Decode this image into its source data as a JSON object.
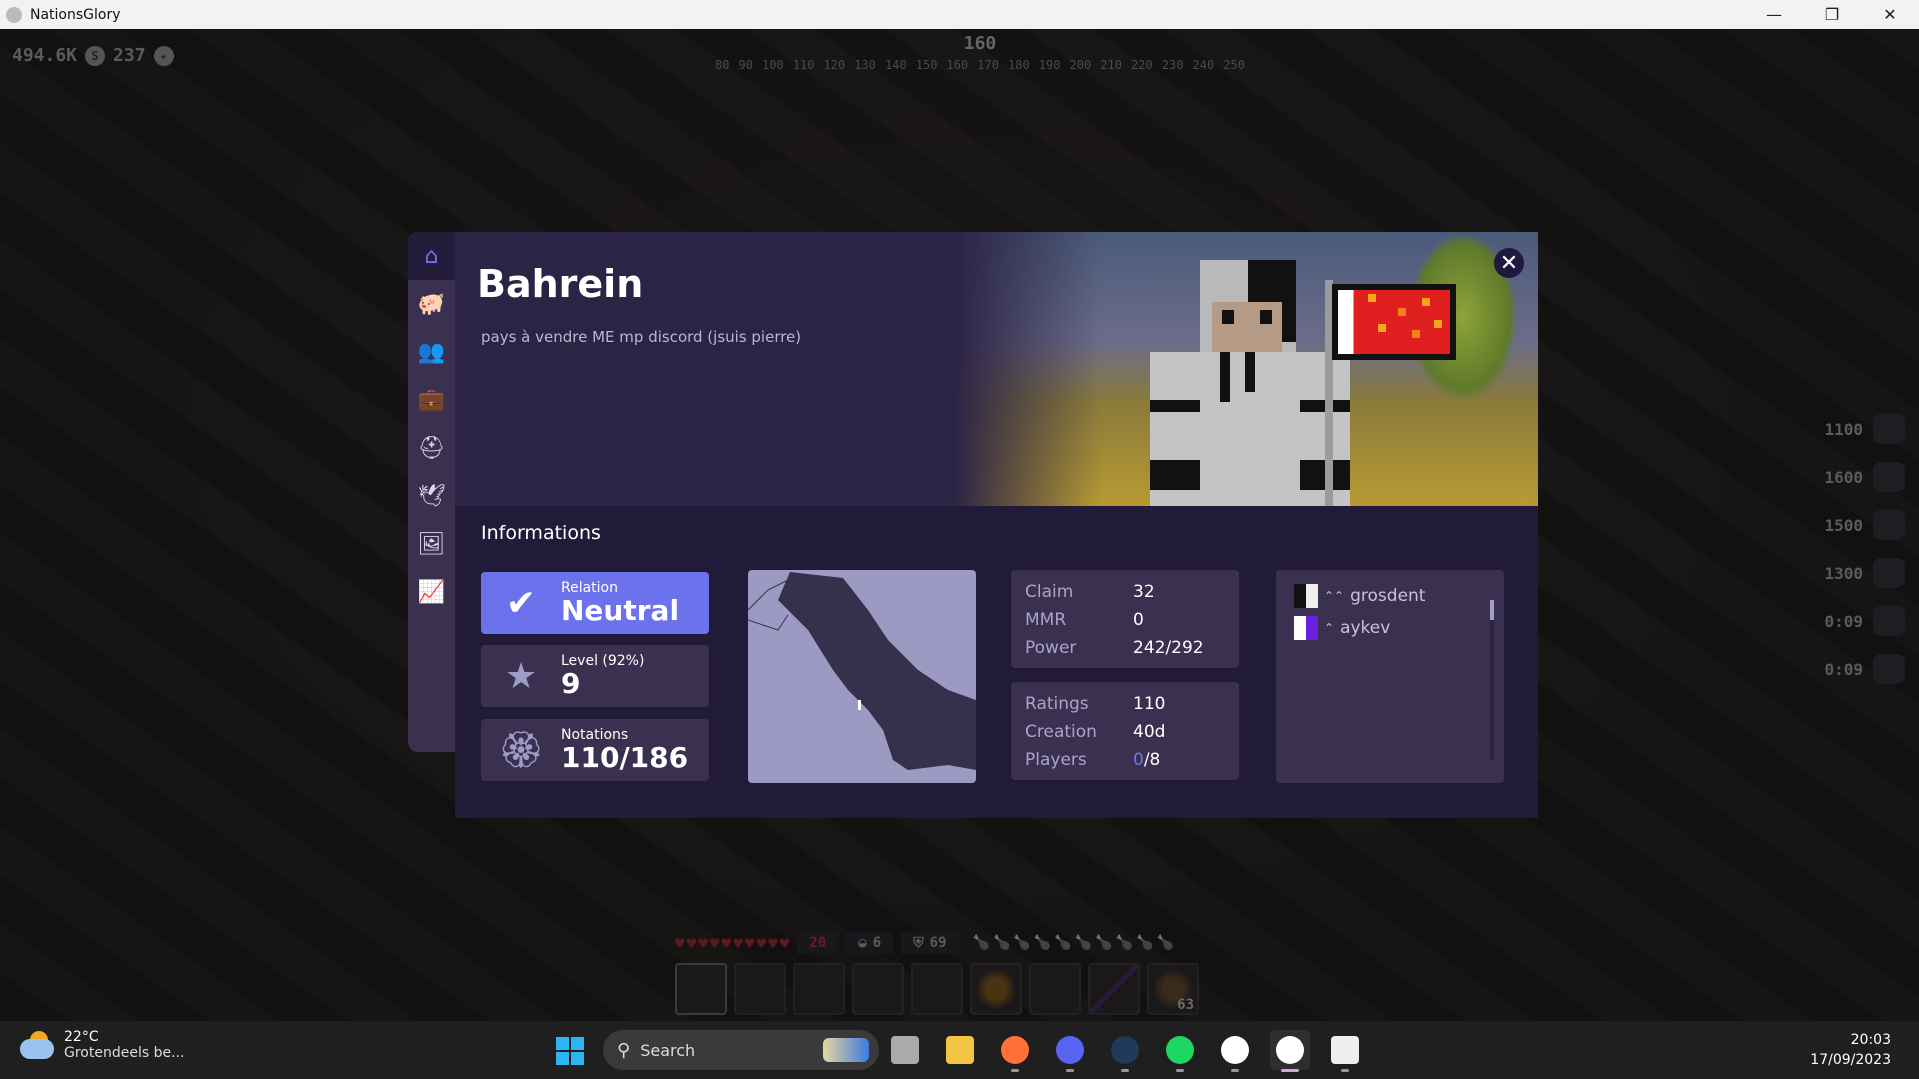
{
  "window": {
    "title": "NationsGlory",
    "controls": [
      {
        "name": "minimize",
        "glyph": "—"
      },
      {
        "name": "restore",
        "glyph": "❐"
      },
      {
        "name": "close",
        "glyph": "✕"
      }
    ]
  },
  "hud": {
    "money": "494.6K",
    "money_icon": "S",
    "points": "237",
    "points_icon": "✦",
    "compass_heading": "160",
    "compass_ticks": [
      "80",
      "90",
      "100",
      "110",
      "120",
      "130",
      "140",
      "150",
      "160",
      "170",
      "180",
      "190",
      "200",
      "210",
      "220",
      "230",
      "240",
      "250"
    ],
    "right_stats": [
      {
        "value": "1100",
        "icon": "helmet-icon"
      },
      {
        "value": "1600",
        "icon": "chestplate-icon"
      },
      {
        "value": "1500",
        "icon": "leggings-icon"
      },
      {
        "value": "1300",
        "icon": "boots-icon"
      },
      {
        "value": "0:09",
        "icon": "claw-effect-icon"
      },
      {
        "value": "0:09",
        "icon": "fire-effect-icon"
      }
    ],
    "hearts": 10,
    "health": "20",
    "mana": "6",
    "armor": "69",
    "food": 10,
    "hotbar": [
      {
        "item": "",
        "count": ""
      },
      {
        "item": "",
        "count": ""
      },
      {
        "item": "",
        "count": ""
      },
      {
        "item": "",
        "count": ""
      },
      {
        "item": "",
        "count": ""
      },
      {
        "item": "backpack",
        "count": ""
      },
      {
        "item": "",
        "count": ""
      },
      {
        "item": "sword",
        "count": ""
      },
      {
        "item": "food",
        "count": "63"
      }
    ]
  },
  "modal": {
    "sidebar": [
      {
        "name": "home",
        "glyph": "⌂",
        "active": true
      },
      {
        "name": "bank",
        "glyph": "🐖",
        "active": false
      },
      {
        "name": "members",
        "glyph": "👥",
        "active": false
      },
      {
        "name": "jobs",
        "glyph": "💼",
        "active": false
      },
      {
        "name": "military",
        "glyph": "⛑",
        "active": false
      },
      {
        "name": "diplomacy",
        "glyph": "🕊",
        "active": false
      },
      {
        "name": "gallery",
        "glyph": "🖼",
        "active": false
      },
      {
        "name": "stats",
        "glyph": "📈",
        "active": false
      }
    ],
    "country_name": "Bahrein",
    "description": "pays à vendre ME mp discord (jsuis pierre)",
    "close_glyph": "✕",
    "section_title": "Informations",
    "relation": {
      "label": "Relation",
      "value": "Neutral",
      "icon": "✔"
    },
    "level": {
      "label": "Level (92%)",
      "value": "9",
      "progress_percent": 92,
      "icon": "★"
    },
    "notations": {
      "label": "Notations",
      "value": "110/186",
      "icon": "🏵"
    },
    "stats_primary": [
      {
        "key": "Claim",
        "value": "32"
      },
      {
        "key": "MMR",
        "value": "0"
      },
      {
        "key": "Power",
        "value": "242/292"
      }
    ],
    "stats_secondary": [
      {
        "key": "Ratings",
        "value": "110"
      },
      {
        "key": "Creation",
        "value": "40d"
      },
      {
        "key": "Players",
        "value_online": "0",
        "value_total": "/8"
      }
    ],
    "members": [
      {
        "rank": "⌃⌃",
        "name": "grosdent"
      },
      {
        "rank": "⌃",
        "name": "aykev"
      }
    ],
    "colors": {
      "accent": "#6b72eb",
      "panel": "#211a38",
      "card": "#3a3150",
      "sidebar": "#3a3150",
      "map_sea": "#9c9ac2",
      "map_land": "#37304d"
    }
  },
  "taskbar": {
    "weather_temp": "22°C",
    "weather_desc": "Grotendeels be...",
    "search_label": "Search",
    "apps": [
      "task-view",
      "file-explorer",
      "firefox",
      "discord",
      "cortana",
      "spotify",
      "nationsglory-launcher",
      "nationsglory",
      "notion"
    ],
    "time": "20:03",
    "date": "17/09/2023"
  }
}
